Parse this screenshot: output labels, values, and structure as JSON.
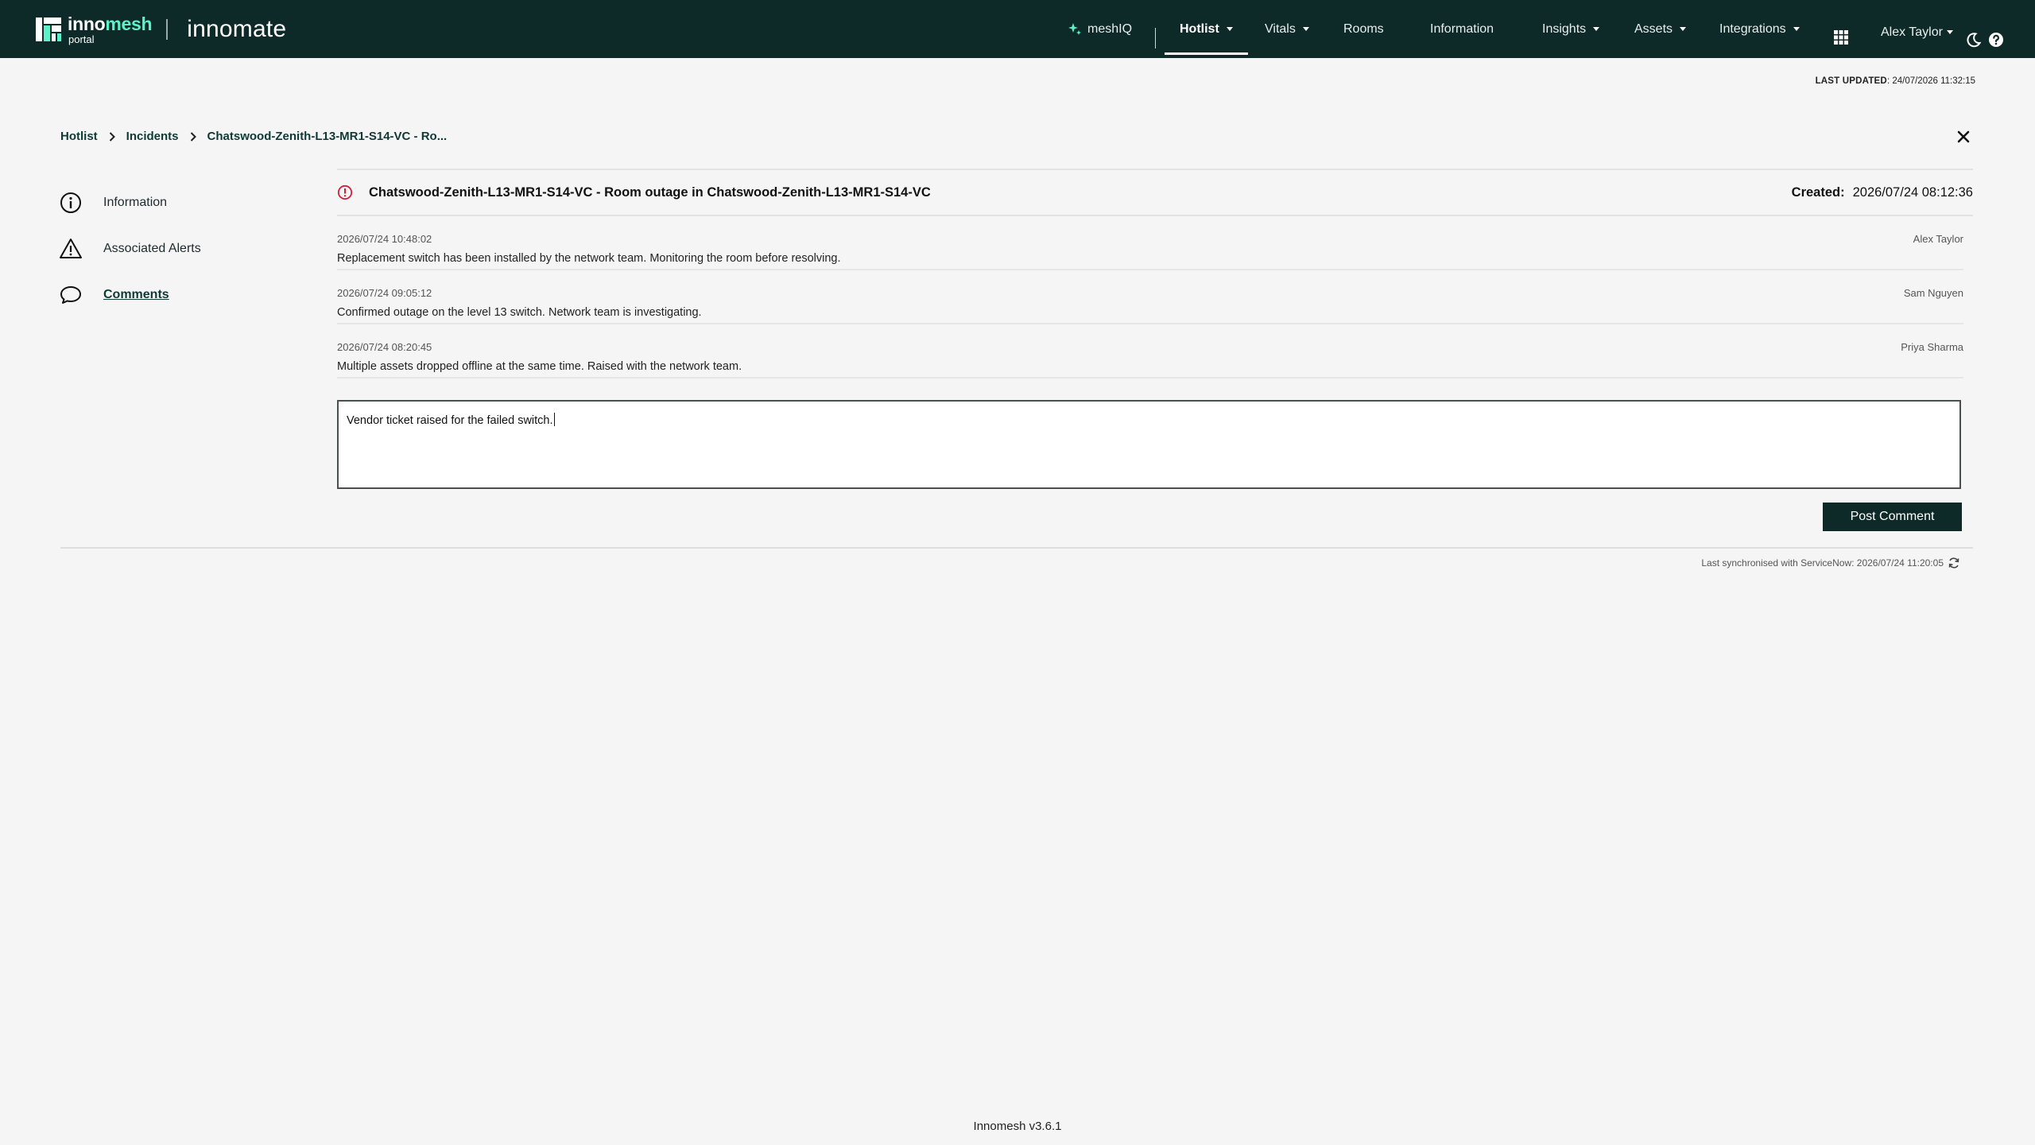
{
  "brand": {
    "name_prefix": "inno",
    "name_suffix": "mesh",
    "sub": "portal",
    "product": "innomate",
    "accent_color": "#5ef0c8",
    "bar_color": "#0e2a28"
  },
  "nav": {
    "meshiq": "meshIQ",
    "hotlist": "Hotlist",
    "vitals": "Vitals",
    "rooms": "Rooms",
    "information": "Information",
    "insights": "Insights",
    "assets": "Assets",
    "integrations": "Integrations",
    "user": "Alex Taylor",
    "icons": [
      "apps-grid-icon",
      "dark-mode-moon-icon",
      "help-icon"
    ]
  },
  "last_updated": {
    "label": "LAST UPDATED",
    "value": ": 24/07/2026 11:32:15"
  },
  "breadcrumb": [
    "Hotlist",
    "Incidents",
    "Chatswood-Zenith-L13-MR1-S14-VC - Ro..."
  ],
  "sidemenu": [
    {
      "label": "Information",
      "icon": "info-icon"
    },
    {
      "label": "Associated Alerts",
      "icon": "warning-icon"
    },
    {
      "label": "Comments",
      "icon": "comment-icon",
      "active": true
    }
  ],
  "incident": {
    "title": "Chatswood-Zenith-L13-MR1-S14-VC - Room outage in Chatswood-Zenith-L13-MR1-S14-VC",
    "created_label": "Created:",
    "created_value": "2026/07/24 08:12:36",
    "status_color": "#d0203a"
  },
  "comments": [
    {
      "timestamp": "2026/07/24 10:48:02",
      "author": "Alex Taylor",
      "body": "Replacement switch has been installed by the network team. Monitoring the room before resolving."
    },
    {
      "timestamp": "2026/07/24 09:05:12",
      "author": "Sam Nguyen",
      "body": "Confirmed outage on the level 13 switch. Network team is investigating."
    },
    {
      "timestamp": "2026/07/24 08:20:45",
      "author": "Priya Sharma",
      "body": "Multiple assets dropped offline at the same time. Raised with the network team."
    }
  ],
  "composer": {
    "value": "Vendor ticket raised for the failed switch.",
    "button": "Post Comment"
  },
  "sync": "Last synchronised with ServiceNow: 2026/07/24 11:20:05",
  "footer": "Innomesh v3.6.1"
}
